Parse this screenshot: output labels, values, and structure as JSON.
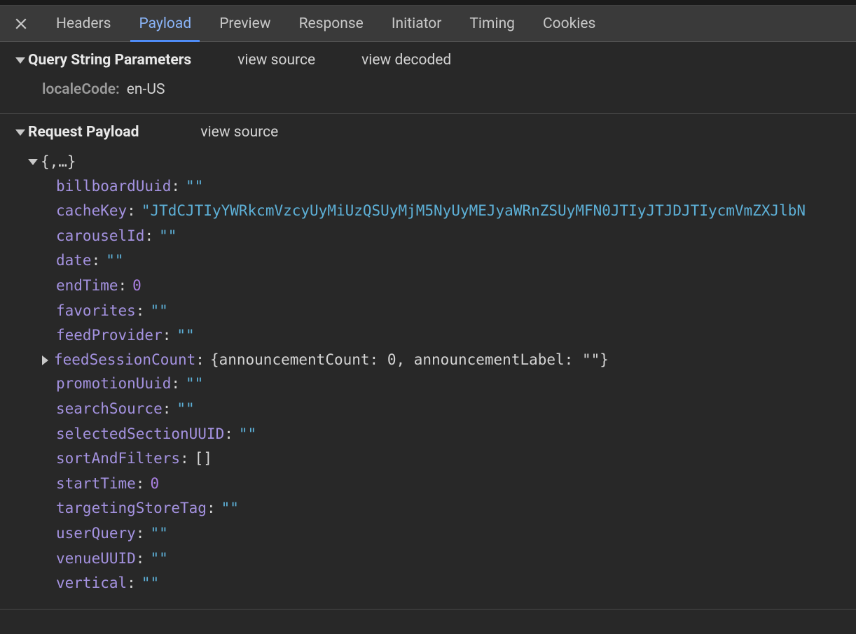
{
  "tabs": {
    "headers": "Headers",
    "payload": "Payload",
    "preview": "Preview",
    "response": "Response",
    "initiator": "Initiator",
    "timing": "Timing",
    "cookies": "Cookies"
  },
  "querySection": {
    "title": "Query String Parameters",
    "viewSource": "view source",
    "viewDecoded": "view decoded",
    "params": {
      "localeCode_key": "localeCode:",
      "localeCode_val": "en-US"
    }
  },
  "requestSection": {
    "title": "Request Payload",
    "viewSource": "view source",
    "root": "{,…}",
    "lines": {
      "billboardUuid_key": "billboardUuid",
      "billboardUuid_val": "\"\"",
      "cacheKey_key": "cacheKey",
      "cacheKey_val": "\"JTdCJTIyYWRkcmVzcyUyMiUzQSUyMjM5NyUyMEJyaWRnZSUyMFN0JTIyJTJDJTIycmVmZXJlbN",
      "carouselId_key": "carouselId",
      "carouselId_val": "\"\"",
      "date_key": "date",
      "date_val": "\"\"",
      "endTime_key": "endTime",
      "endTime_val": "0",
      "favorites_key": "favorites",
      "favorites_val": "\"\"",
      "feedProvider_key": "feedProvider",
      "feedProvider_val": "\"\"",
      "feedSessionCount_key": "feedSessionCount",
      "feedSessionCount_val": "{announcementCount: 0, announcementLabel: \"\"}",
      "promotionUuid_key": "promotionUuid",
      "promotionUuid_val": "\"\"",
      "searchSource_key": "searchSource",
      "searchSource_val": "\"\"",
      "selectedSectionUUID_key": "selectedSectionUUID",
      "selectedSectionUUID_val": "\"\"",
      "sortAndFilters_key": "sortAndFilters",
      "sortAndFilters_val": "[]",
      "startTime_key": "startTime",
      "startTime_val": "0",
      "targetingStoreTag_key": "targetingStoreTag",
      "targetingStoreTag_val": "\"\"",
      "userQuery_key": "userQuery",
      "userQuery_val": "\"\"",
      "venueUUID_key": "venueUUID",
      "venueUUID_val": "\"\"",
      "vertical_key": "vertical",
      "vertical_val": "\"\""
    }
  }
}
